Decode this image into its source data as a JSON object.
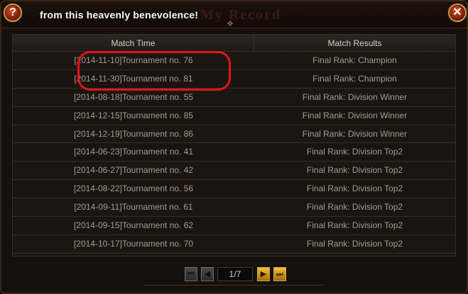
{
  "title_faded": "My Record",
  "banner_text": "from this heavenly benevolence!",
  "help_label": "?",
  "close_label": "✕",
  "table": {
    "headers": [
      "Match Time",
      "Match Results"
    ],
    "rows": [
      {
        "time": "[2014-11-10]Tournament no. 76",
        "result": "Final Rank: Champion"
      },
      {
        "time": "[2014-11-30]Tournament no. 81",
        "result": "Final Rank: Champion"
      },
      {
        "time": "[2014-08-18]Tournament no. 55",
        "result": "Final Rank: Division Winner"
      },
      {
        "time": "[2014-12-15]Tournament no. 85",
        "result": "Final Rank: Division Winner"
      },
      {
        "time": "[2014-12-19]Tournament no. 86",
        "result": "Final Rank: Division Winner"
      },
      {
        "time": "[2014-06-23]Tournament no. 41",
        "result": "Final Rank: Division Top2"
      },
      {
        "time": "[2014-06-27]Tournament no. 42",
        "result": "Final Rank: Division Top2"
      },
      {
        "time": "[2014-08-22]Tournament no. 56",
        "result": "Final Rank: Division Top2"
      },
      {
        "time": "[2014-09-11]Tournament no. 61",
        "result": "Final Rank: Division Top2"
      },
      {
        "time": "[2014-09-15]Tournament no. 62",
        "result": "Final Rank: Division Top2"
      },
      {
        "time": "[2014-10-17]Tournament no. 70",
        "result": "Final Rank: Division Top2"
      }
    ]
  },
  "pager": {
    "first": "⏮",
    "prev": "◀",
    "page": "1/7",
    "next": "▶",
    "last": "⏭"
  },
  "colors": {
    "highlight": "#e0141a",
    "accent_gold": "#f4c23a"
  }
}
